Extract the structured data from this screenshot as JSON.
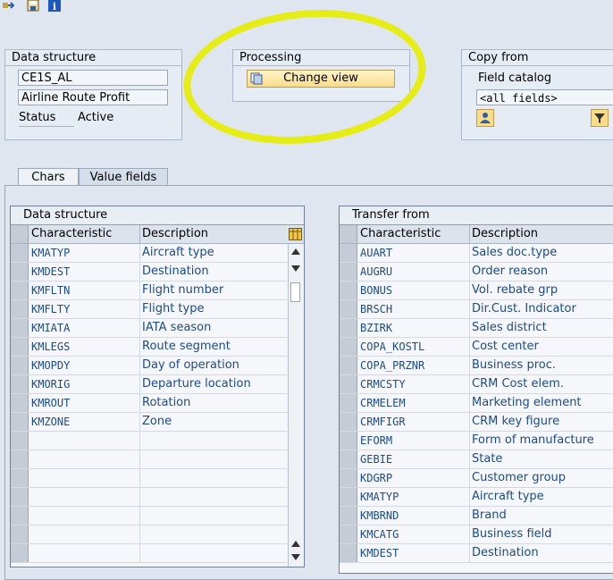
{
  "toolbar": {
    "icons": [
      "transport-icon",
      "save-local-icon",
      "info-icon"
    ]
  },
  "data_structure_box": {
    "title": "Data structure",
    "name_value": "CE1S_AL",
    "description_value": "Airline Route Profit",
    "status_label": "Status",
    "status_value": "Active"
  },
  "processing_box": {
    "title": "Processing",
    "button_label": "Change view"
  },
  "copy_from_box": {
    "title": "Copy from",
    "label": "Field catalog",
    "select_value": "<all fields>"
  },
  "tabs": [
    {
      "label": "Chars"
    },
    {
      "label": "Value fields"
    }
  ],
  "left_table": {
    "title": "Data structure",
    "headers": [
      "Characteristic",
      "Description"
    ],
    "rows": [
      {
        "code": "KMATYP",
        "desc": "Aircraft type"
      },
      {
        "code": "KMDEST",
        "desc": "Destination"
      },
      {
        "code": "KMFLTN",
        "desc": "Flight number"
      },
      {
        "code": "KMFLTY",
        "desc": "Flight type"
      },
      {
        "code": "KMIATA",
        "desc": "IATA season"
      },
      {
        "code": "KMLEGS",
        "desc": "Route segment"
      },
      {
        "code": "KMOPDY",
        "desc": "Day of operation"
      },
      {
        "code": "KMORIG",
        "desc": "Departure location"
      },
      {
        "code": "KMROUT",
        "desc": "Rotation"
      },
      {
        "code": "KMZONE",
        "desc": "Zone"
      }
    ],
    "empty_rows": 7
  },
  "right_table": {
    "title": "Transfer from",
    "headers": [
      "Characteristic",
      "Description"
    ],
    "rows": [
      {
        "code": "AUART",
        "desc": "Sales doc.type"
      },
      {
        "code": "AUGRU",
        "desc": "Order reason"
      },
      {
        "code": "BONUS",
        "desc": "Vol. rebate grp"
      },
      {
        "code": "BRSCH",
        "desc": "Dir.Cust. Indicator"
      },
      {
        "code": "BZIRK",
        "desc": "Sales district"
      },
      {
        "code": "COPA_KOSTL",
        "desc": "Cost center"
      },
      {
        "code": "COPA_PRZNR",
        "desc": "Business proc."
      },
      {
        "code": "CRMCSTY",
        "desc": "CRM Cost elem."
      },
      {
        "code": "CRMELEM",
        "desc": "Marketing element"
      },
      {
        "code": "CRMFIGR",
        "desc": "CRM key figure"
      },
      {
        "code": "EFORM",
        "desc": "Form of manufacture"
      },
      {
        "code": "GEBIE",
        "desc": "State"
      },
      {
        "code": "KDGRP",
        "desc": "Customer group"
      },
      {
        "code": "KMATYP",
        "desc": "Aircraft type"
      },
      {
        "code": "KMBRND",
        "desc": "Brand"
      },
      {
        "code": "KMCATG",
        "desc": "Business field"
      },
      {
        "code": "KMDEST",
        "desc": "Destination"
      }
    ]
  },
  "colors": {
    "highlight_circle": "#e6ec16",
    "link_text": "#1c4a8e",
    "button_fill": "#f8dc8a"
  }
}
